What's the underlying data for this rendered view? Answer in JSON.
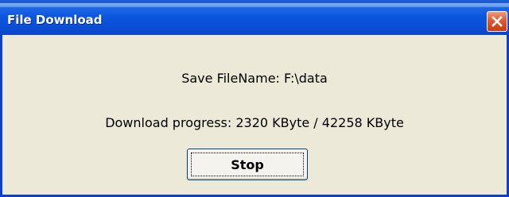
{
  "window": {
    "title": "File Download"
  },
  "dialog": {
    "save_filename": "Save FileName: F:\\data",
    "progress": "Download progress: 2320 KByte / 42258 KByte",
    "stop_label": "Stop"
  },
  "icons": {
    "close": "close-icon"
  },
  "colors": {
    "titlebar": "#0a55de",
    "frame": "#0a3fd6",
    "close_button": "#e2572f",
    "dialog_background": "#ece9d8"
  }
}
